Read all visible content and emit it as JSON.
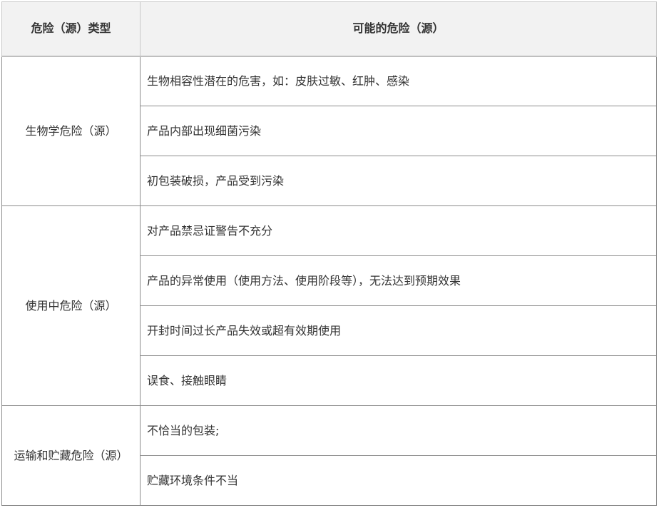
{
  "header": {
    "col1": "危险（源）类型",
    "col2": "可能的危险（源）"
  },
  "groups": [
    {
      "category": "生物学危险（源）",
      "hazards": [
        "生物相容性潜在的危害，如：皮肤过敏、红肿、感染",
        "产品内部出现细菌污染",
        "初包装破损，产品受到污染"
      ]
    },
    {
      "category": "使用中危险（源）",
      "hazards": [
        "对产品禁忌证警告不充分",
        "产品的异常使用（使用方法、使用阶段等），无法达到预期效果",
        "开封时间过长产品失效或超有效期使用",
        "误食、接触眼睛"
      ]
    },
    {
      "category": "运输和贮藏危险（源）",
      "hazards": [
        "不恰当的包装;",
        "贮藏环境条件不当"
      ]
    }
  ]
}
